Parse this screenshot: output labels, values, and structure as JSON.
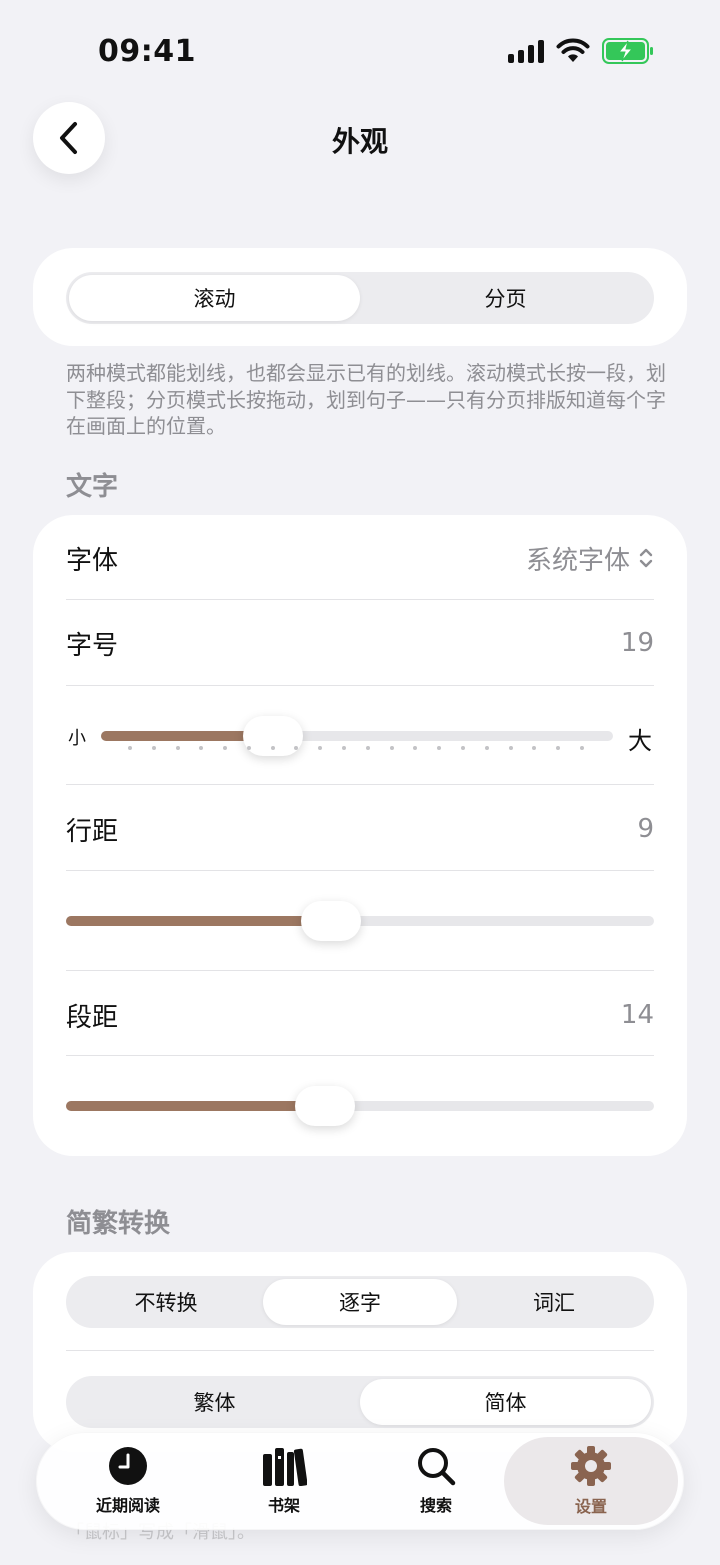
{
  "status": {
    "time": "09:41"
  },
  "header": {
    "title": "外观"
  },
  "mode": {
    "options": [
      "滚动",
      "分页"
    ],
    "selected": 0
  },
  "mode_note": "两种模式都能划线，也都会显示已有的划线。滚动模式长按一段，划下整段；分页模式长按拖动，划到句子——只有分页排版知道每个字在画面上的位置。",
  "text_section": {
    "label": "文字",
    "font": {
      "label": "字体",
      "value": "系统字体"
    },
    "size": {
      "label": "字号",
      "value": "19",
      "min_label": "小",
      "max_label": "大",
      "level": 0.335
    },
    "line_spacing": {
      "label": "行距",
      "value": "9",
      "level": 0.45
    },
    "para_spacing": {
      "label": "段距",
      "value": "14",
      "level": 0.44
    }
  },
  "conversion_section": {
    "label": "简繁转换",
    "mode_options": [
      "不转换",
      "逐字",
      "词汇"
    ],
    "mode_selected": 1,
    "script_options": [
      "繁体",
      "简体"
    ],
    "script_selected": 1
  },
  "peek_text": "「鼠标」写成「滑鼠」。",
  "tab_bar": {
    "items": [
      {
        "label": "近期阅读",
        "icon": "clock-icon"
      },
      {
        "label": "书架",
        "icon": "books-icon"
      },
      {
        "label": "搜索",
        "icon": "search-icon"
      },
      {
        "label": "设置",
        "icon": "gear-icon"
      }
    ],
    "active": 3
  },
  "colors": {
    "accent": "#9c7761",
    "active_tab": "#8a6450",
    "battery_green": "#34c759"
  }
}
